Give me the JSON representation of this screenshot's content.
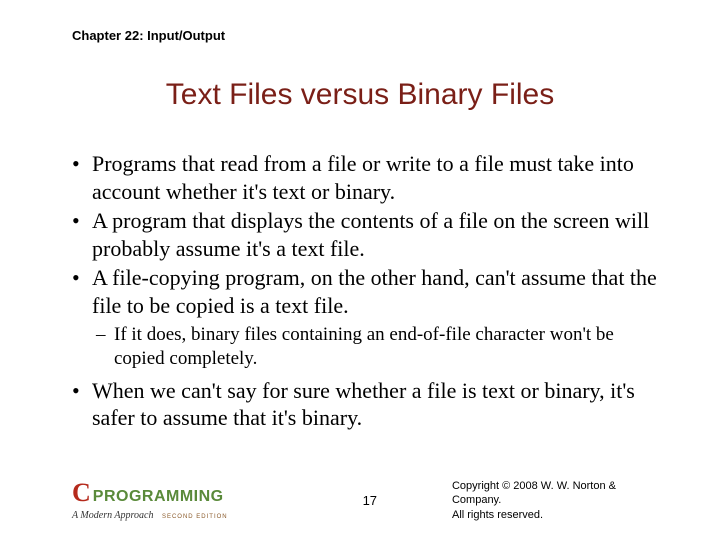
{
  "chapter": "Chapter 22: Input/Output",
  "title": "Text Files versus Binary Files",
  "bullets": {
    "b1": "Programs that read from a file or write to a file must take into account whether it's text or binary.",
    "b2": "A program that displays the contents of a file on the screen will probably assume it's a text file.",
    "b3": "A file-copying program, on the other hand, can't assume that the file to be copied is a text file.",
    "b3_sub1": "If it does, binary files containing an end-of-file character won't be copied completely.",
    "b4": "When we can't say for sure whether a file is text or binary, it's safer to assume that it's binary."
  },
  "footer": {
    "logo_c": "C",
    "logo_prog": "PROGRAMMING",
    "logo_sub": "A Modern Approach",
    "logo_ed": "SECOND EDITION",
    "page": "17",
    "copyright_line1": "Copyright © 2008 W. W. Norton & Company.",
    "copyright_line2": "All rights reserved."
  }
}
